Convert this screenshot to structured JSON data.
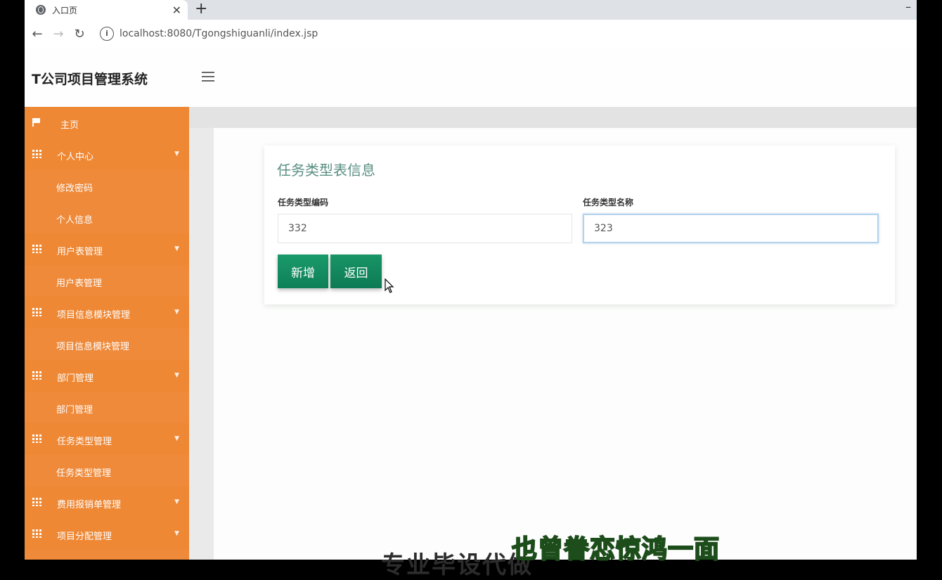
{
  "browser": {
    "tab_title": "入口页",
    "new_tab": "+",
    "close_tab": "✕",
    "minimize": "–",
    "url": "localhost:8080/Tgongshiguanli/index.jsp"
  },
  "header": {
    "brand": "T公司项目管理系统"
  },
  "sidebar": {
    "items": [
      {
        "label": "主页",
        "type": "home"
      },
      {
        "label": "个人中心",
        "type": "group"
      },
      {
        "label": "修改密码",
        "type": "sub"
      },
      {
        "label": "个人信息",
        "type": "sub"
      },
      {
        "label": "用户表管理",
        "type": "group"
      },
      {
        "label": "用户表管理",
        "type": "sub"
      },
      {
        "label": "项目信息模块管理",
        "type": "group"
      },
      {
        "label": "项目信息模块管理",
        "type": "sub"
      },
      {
        "label": "部门管理",
        "type": "group"
      },
      {
        "label": "部门管理",
        "type": "sub"
      },
      {
        "label": "任务类型管理",
        "type": "group"
      },
      {
        "label": "任务类型管理",
        "type": "sub"
      },
      {
        "label": "费用报销单管理",
        "type": "group"
      },
      {
        "label": "项目分配管理",
        "type": "group"
      }
    ]
  },
  "form": {
    "title": "任务类型表信息",
    "code_label": "任务类型编码",
    "code_value": "332",
    "name_label": "任务类型名称",
    "name_value": "323",
    "add_button": "新增",
    "back_button": "返回"
  },
  "subtitles": {
    "line1": "也曾眷恋惊鸿一面",
    "line2": "专业毕设代做"
  },
  "colors": {
    "sidebar": "#ef8a3a",
    "button": "#129068",
    "title": "#5a8f83"
  }
}
